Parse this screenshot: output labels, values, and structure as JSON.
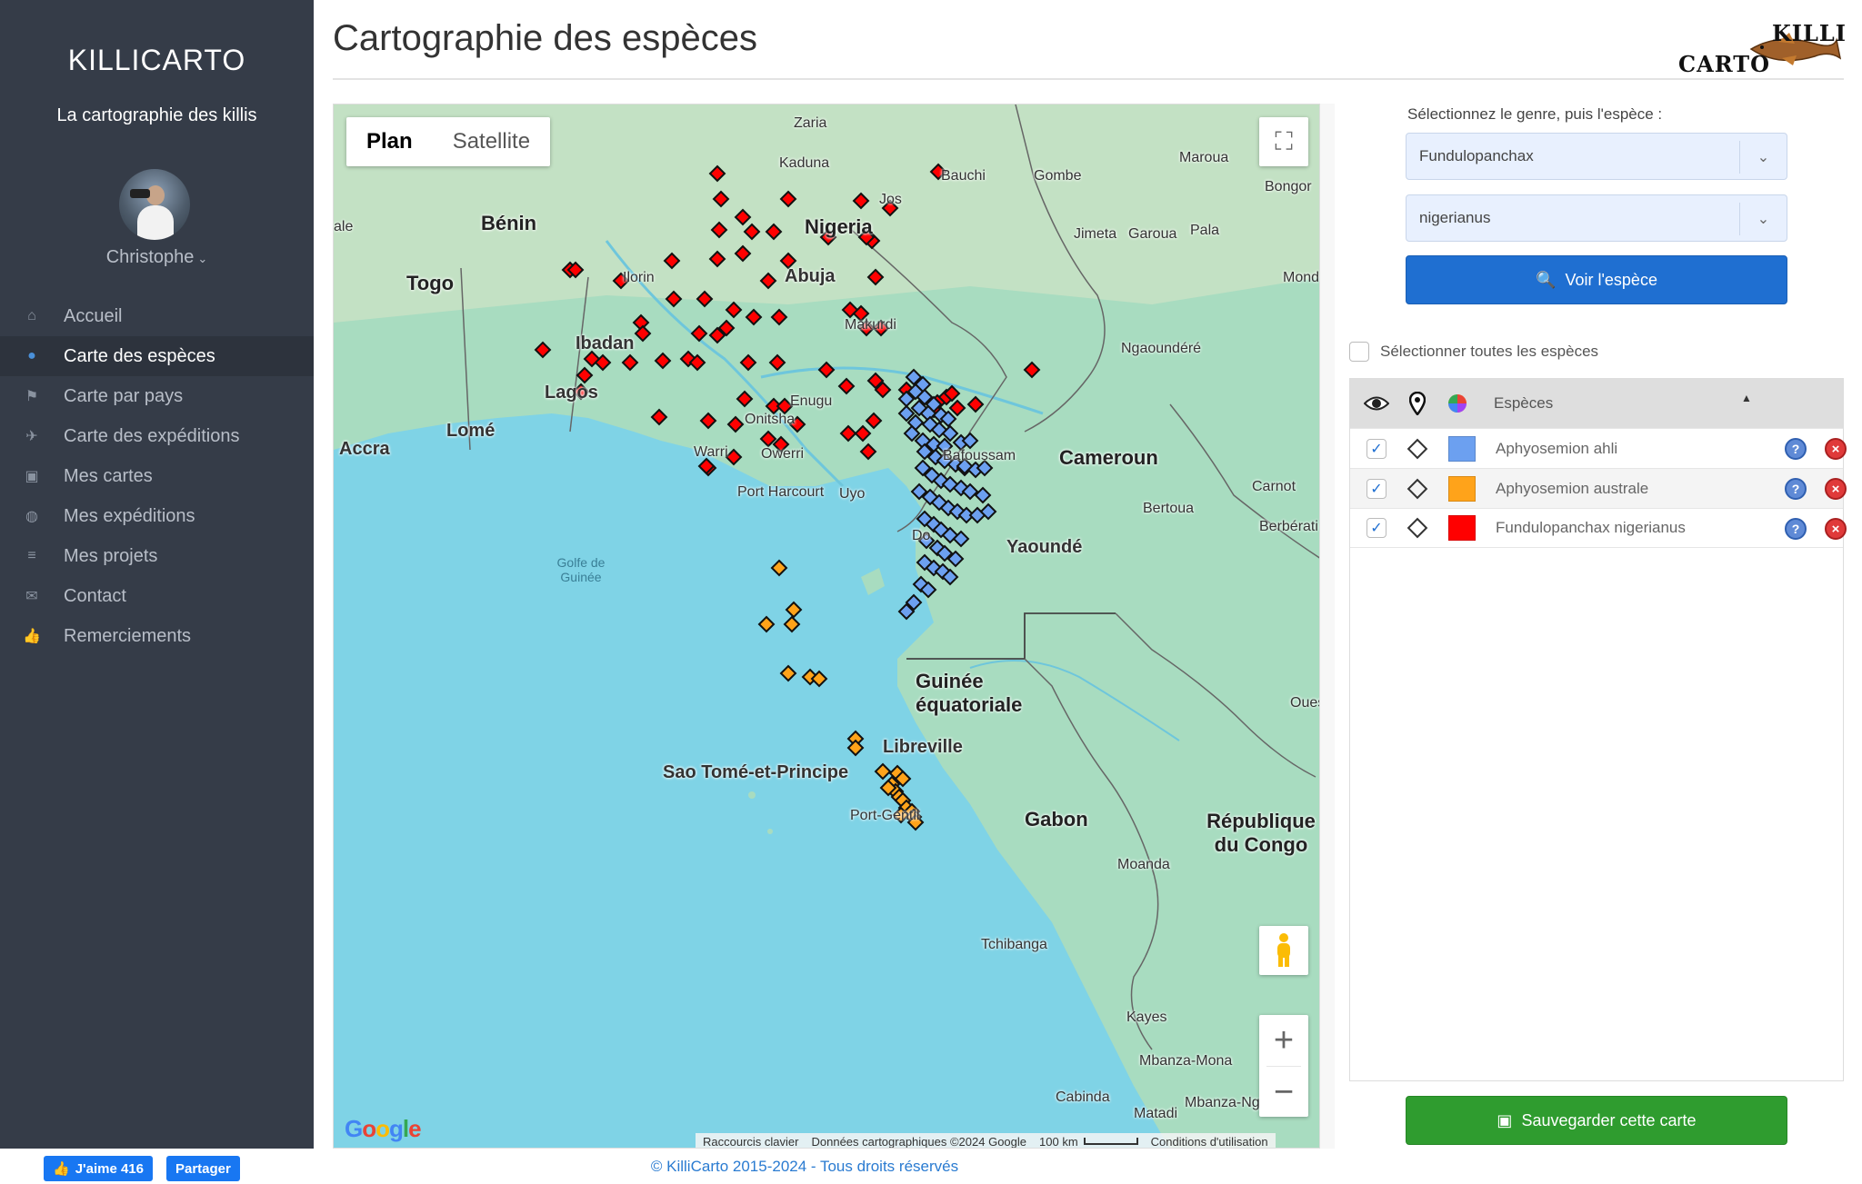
{
  "sidebar": {
    "brand": "KILLICARTO",
    "tagline": "La cartographie des killis",
    "user": "Christophe",
    "items": [
      {
        "label": "Accueil",
        "icon": "home-icon"
      },
      {
        "label": "Carte des espèces",
        "icon": "map-pin-icon",
        "active": true
      },
      {
        "label": "Carte par pays",
        "icon": "flag-icon"
      },
      {
        "label": "Carte des expéditions",
        "icon": "plane-icon"
      },
      {
        "label": "Mes cartes",
        "icon": "floppy-icon"
      },
      {
        "label": "Mes expéditions",
        "icon": "globe-icon"
      },
      {
        "label": "Mes projets",
        "icon": "list-icon"
      },
      {
        "label": "Contact",
        "icon": "envelope-icon"
      },
      {
        "label": "Remerciements",
        "icon": "thumbs-up-icon"
      }
    ]
  },
  "header": {
    "title": "Cartographie des espèces",
    "logo_top": "KILLI",
    "logo_bottom": "CARTO"
  },
  "map": {
    "type_plan": "Plan",
    "type_satellite": "Satellite",
    "google": "Google",
    "attribution_keyboard": "Raccourcis clavier",
    "attribution_data": "Données cartographiques ©2024 Google",
    "scale": "100 km",
    "terms": "Conditions d'utilisation",
    "labels": {
      "zaria": "Zaria",
      "kaduna": "Kaduna",
      "bauchi": "Bauchi",
      "gombe": "Gombe",
      "maroua": "Maroua",
      "jos": "Jos",
      "benin": "Bénin",
      "nigeria": "Nigeria",
      "bongor": "Bongor",
      "ale": "ale",
      "pala": "Pala",
      "jimeta": "Jimeta",
      "garoua": "Garoua",
      "togo": "Togo",
      "ilorin": "Ilorin",
      "abuja": "Abuja",
      "mondo": "Mondo",
      "ibadan": "Ibadan",
      "makurdi": "Makurdi",
      "ngaoundere": "Ngaoundéré",
      "lagos": "Lagos",
      "enugu": "Enugu",
      "onitsha": "Onitsha",
      "lome": "Lomé",
      "accra": "Accra",
      "warri": "Warri",
      "owerri": "Owerri",
      "bafoussam": "Bafoussam",
      "cameroun": "Cameroun",
      "port_harcourt": "Port Harcourt",
      "uyo": "Uyo",
      "carnot": "Carnot",
      "bertoua": "Bertoua",
      "berberati": "Berbérati",
      "yaounde": "Yaoundé",
      "gulf": "Golfe de Guinée",
      "guinee_eq": "Guinée équatoriale",
      "ouesso": "Oues",
      "libreville": "Libreville",
      "sao_tome": "Sao Tomé-et-Principe",
      "port_gentil": "Port-Gentil",
      "gabon": "Gabon",
      "rep_congo": "République du Congo",
      "moanda": "Moanda",
      "tchibanga": "Tchibanga",
      "kayes": "Kayes",
      "mbanza_mona": "Mbanza-Mona",
      "cabinda": "Cabinda",
      "matadi": "Matadi",
      "mbanza_ng": "Mbanza-Ng",
      "douala": "Do"
    },
    "markers": {
      "red_count": 74,
      "blue_count": 60,
      "orange_count": 22
    }
  },
  "panel": {
    "prompt": "Sélectionnez le genre, puis l'espèce :",
    "genus": "Fundulopanchax",
    "species": "nigerianus",
    "view_button": "Voir l'espèce",
    "select_all": "Sélectionner toutes les espèces",
    "column_header": "Espèces",
    "rows": [
      {
        "name": "Aphyosemion ahli",
        "color": "#6ca0f0"
      },
      {
        "name": "Aphyosemion australe",
        "color": "#ffa31a"
      },
      {
        "name": "Fundulopanchax nigerianus",
        "color": "#ff0000"
      }
    ],
    "save_button": "Sauvegarder cette carte"
  },
  "footer": {
    "like": "J'aime 416",
    "share": "Partager",
    "copyright": "© KilliCarto 2015-2024 - Tous droits réservés"
  },
  "colors": {
    "sidebar_bg": "#353c48",
    "primary": "#1f6fd1",
    "success": "#2f9c2f",
    "sea": "#7fd3e6",
    "land": "#a8dcc0"
  }
}
